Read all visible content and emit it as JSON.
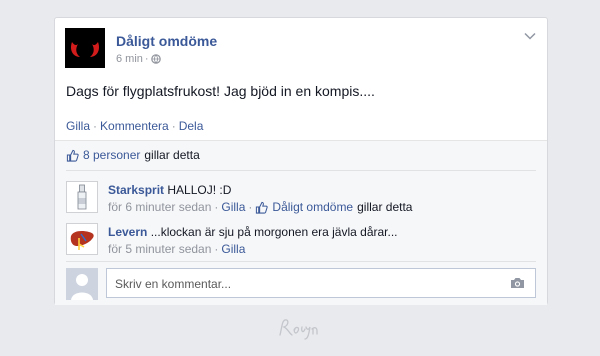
{
  "post": {
    "page_name": "Dåligt omdöme",
    "time": "6 min",
    "text": "Dags för flygplatsfrukost! Jag bjöd in en kompis....",
    "actions": {
      "like": "Gilla",
      "comment": "Kommentera",
      "share": "Dela"
    }
  },
  "likes": {
    "count_text": "8 personer",
    "suffix": "gillar detta"
  },
  "comments": [
    {
      "author": "Starksprit",
      "text": "HALLOJ! :D",
      "time": "för 6 minuter sedan",
      "like": "Gilla",
      "liked_by": "Dåligt omdöme",
      "liked_suffix": "gillar detta"
    },
    {
      "author": "Levern",
      "text": "...klockan är sju på morgonen era jävla dårar...",
      "time": "för 5 minuter sedan",
      "like": "Gilla"
    }
  ],
  "composer": {
    "placeholder": "Skriv en kommentar..."
  },
  "colors": {
    "link": "#3b5998",
    "meta": "#90949c",
    "background": "#e9eaed"
  },
  "icons": [
    "devil-horns-icon",
    "globe-icon",
    "chevron-down-icon",
    "thumbs-up-icon",
    "camera-icon",
    "bottle-icon",
    "liver-icon"
  ]
}
